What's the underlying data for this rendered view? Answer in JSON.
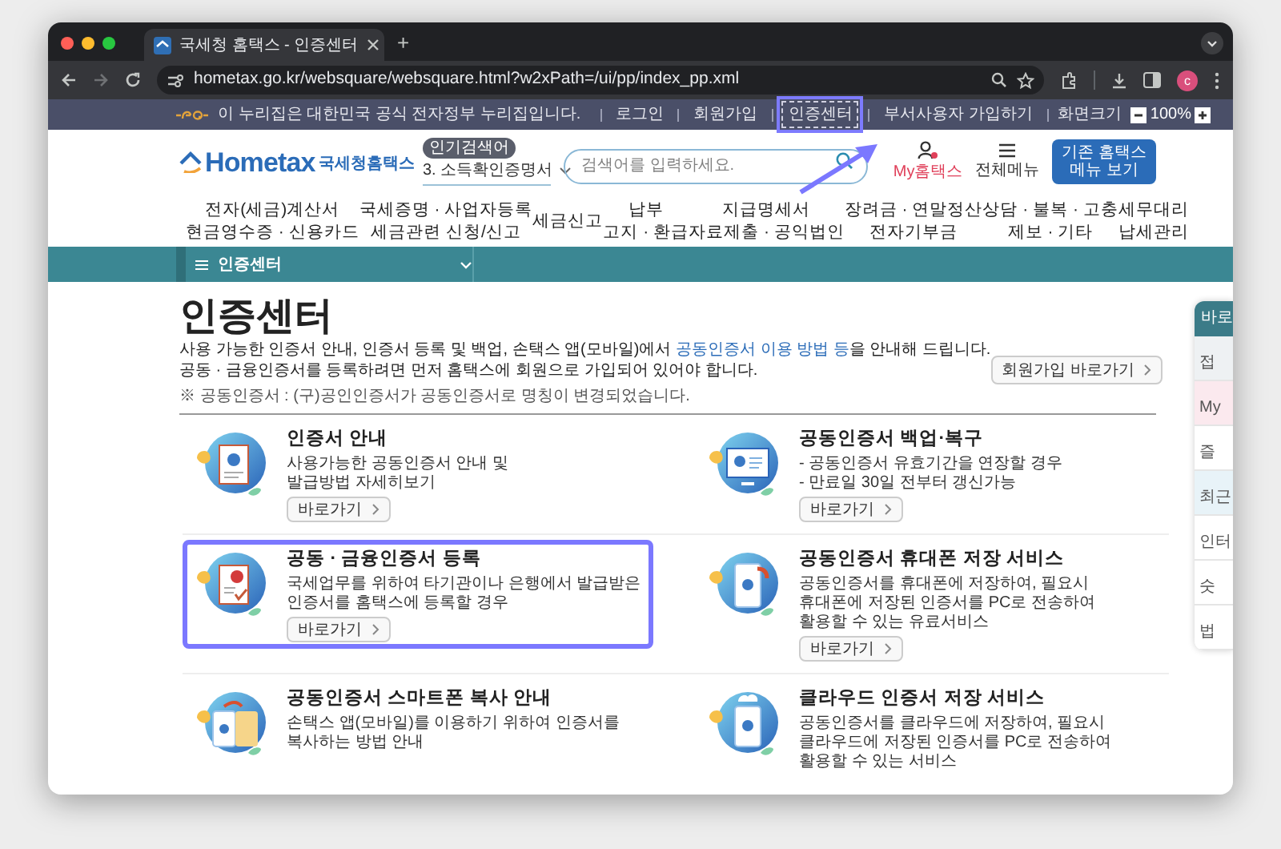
{
  "browser": {
    "tab_title": "국세청 홈택스 - 인증센터",
    "new_tab": "+",
    "url": "hometax.go.kr/websquare/websquare.html?w2xPath=/ui/pp/index_pp.xml",
    "profile_initial": "c"
  },
  "gov_banner": {
    "text": "이 누리집은 대한민국 공식 전자정부 누리집입니다.",
    "links": [
      {
        "label": "로그인",
        "highlighted": false
      },
      {
        "label": "회원가입",
        "highlighted": false
      },
      {
        "label": "인증센터",
        "highlighted": true
      },
      {
        "label": "부서사용자 가입하기",
        "highlighted": false
      }
    ],
    "screen_size_label": "화면크기",
    "zoom": "100%"
  },
  "header": {
    "logo_text": "Hometax",
    "logo_sub": "국세청홈택스",
    "popular_badge": "인기검색어",
    "popular_item": "3.  소득확인증명서",
    "search_placeholder": "검색어를 입력하세요.",
    "my_label": "My홈택스",
    "menu_label": "전체메뉴",
    "legacy_button": [
      "기존 홈택스",
      "메뉴 보기"
    ]
  },
  "nav": [
    {
      "lines": [
        "전자(세금)계산서",
        "현금영수증 · 신용카드"
      ]
    },
    {
      "lines": [
        "국세증명 · 사업자등록",
        "세금관련 신청/신고"
      ]
    },
    {
      "lines": [
        "세금신고"
      ]
    },
    {
      "lines": [
        "납부",
        "고지 · 환급"
      ]
    },
    {
      "lines": [
        "지급명세서",
        "자료제출 · 공익법인"
      ]
    },
    {
      "lines": [
        "장려금 · 연말정산",
        "전자기부금"
      ]
    },
    {
      "lines": [
        "상담 · 불복 · 고충",
        "제보 · 기타"
      ]
    },
    {
      "lines": [
        "세무대리",
        "납세관리"
      ]
    }
  ],
  "breadcrumb": "인증센터",
  "page": {
    "title": "인증센터",
    "intro": [
      {
        "before": "사용 가능한 인증서 안내, 인증서 등록 및 백업, 손택스 앱(모바일)에서 ",
        "link": "공동인증서 이용 방법 등",
        "after": "을 안내해 드립니다."
      },
      {
        "before": "공동 · 금융인증서를 등록하려면 먼저 홈택스에 회원으로 가입되어 있어야 합니다."
      }
    ],
    "note": "※ 공동인증서 : (구)공인인증서가 공동인증서로 명칭이 변경되었습니다.",
    "join_button": "회원가입 바로가기"
  },
  "cards": [
    {
      "kind": "document",
      "title": "인증서 안내",
      "lines": [
        "사용가능한 공동인증서 안내 및",
        "발급방법 자세히보기"
      ],
      "button": "바로가기",
      "highlighted": false
    },
    {
      "kind": "monitor",
      "title": "공동인증서 백업·복구",
      "lines": [
        "-  공동인증서 유효기간을 연장할 경우",
        "-  만료일 30일 전부터 갱신가능"
      ],
      "button": "바로가기",
      "highlighted": false
    },
    {
      "kind": "award",
      "title": "공동 · 금융인증서 등록",
      "lines": [
        "국세업무를 위하여 타기관이나 은행에서 발급받은",
        "인증서를 홈택스에 등록할 경우"
      ],
      "button": "바로가기",
      "highlighted": true
    },
    {
      "kind": "phone",
      "title": "공동인증서 휴대폰 저장 서비스",
      "lines": [
        "공동인증서를 휴대폰에 저장하여, 필요시",
        "휴대폰에 저장된 인증서를 PC로 전송하여",
        "활용할 수 있는 유료서비스"
      ],
      "button": "바로가기",
      "highlighted": false
    },
    {
      "kind": "copy",
      "title": "공동인증서 스마트폰 복사 안내",
      "lines": [
        "손택스 앱(모바일)를 이용하기 위하여 인증서를",
        "복사하는 방법 안내"
      ],
      "highlighted": false
    },
    {
      "kind": "cloud",
      "title": "클라우드 인증서 저장 서비스",
      "lines": [
        "공동인증서를 클라우드에 저장하여, 필요시",
        "클라우드에 저장된 인증서를 PC로 전송하여",
        "활용할 수 있는 서비스"
      ],
      "highlighted": false
    }
  ],
  "quick_panel": {
    "heading": "바로",
    "items": [
      {
        "label": "접",
        "color": "#eef1f3"
      },
      {
        "label": "My",
        "color": "#fbe9ee"
      },
      {
        "label": "즐",
        "color": "#ffffff"
      },
      {
        "label": "최근",
        "color": "#e8f3f8"
      },
      {
        "label": "인터",
        "color": "#ffffff"
      },
      {
        "label": "숫",
        "color": "#ffffff"
      },
      {
        "label": "법",
        "color": "#ffffff"
      }
    ]
  }
}
